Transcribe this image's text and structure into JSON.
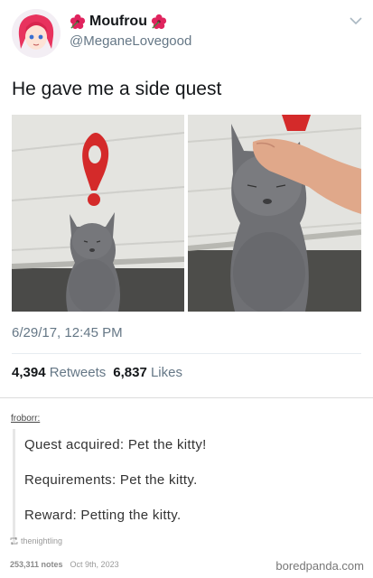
{
  "tweet": {
    "display_name": "Moufrou",
    "handle": "@MeganeLovegood",
    "text": "He gave me a side quest",
    "timestamp": "6/29/17, 12:45 PM",
    "retweets_count": "4,394",
    "retweets_label": "Retweets",
    "likes_count": "6,837",
    "likes_label": "Likes",
    "icons": [
      "avatar",
      "hibiscus-icon",
      "chevron-down-icon"
    ]
  },
  "post": {
    "username": "froborr:",
    "lines": [
      "Quest acquired: Pet the kitty!",
      "Requirements: Pet the kitty.",
      "Reward: Petting the kitty."
    ],
    "reblog_source": "thenightling",
    "notes": "253,311 notes",
    "date": "Oct 9th, 2023"
  },
  "watermark": "boredpanda.com",
  "colors": {
    "secondary_text": "#657786",
    "quest_marker": "#d42a2a",
    "divider": "#e6ecf0"
  }
}
